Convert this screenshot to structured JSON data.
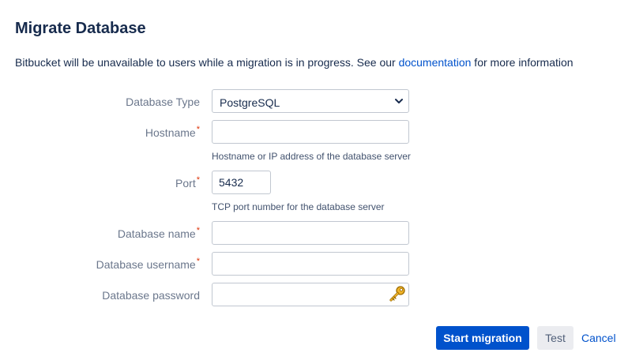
{
  "page": {
    "title": "Migrate Database",
    "intro_before": "Bitbucket will be unavailable to users while a migration is in progress. See our ",
    "intro_link": "documentation",
    "intro_after": " for more information"
  },
  "form": {
    "required_marker": "*",
    "database_type": {
      "label": "Database Type",
      "value": "PostgreSQL"
    },
    "hostname": {
      "label": "Hostname",
      "value": "",
      "help": "Hostname or IP address of the database server"
    },
    "port": {
      "label": "Port",
      "value": "5432",
      "help": "TCP port number for the database server"
    },
    "database_name": {
      "label": "Database name",
      "value": ""
    },
    "database_username": {
      "label": "Database username",
      "value": ""
    },
    "database_password": {
      "label": "Database password",
      "value": ""
    }
  },
  "actions": {
    "start_label": "Start migration",
    "test_label": "Test",
    "cancel_label": "Cancel"
  },
  "icons": {
    "select_chevron": "chevron-down-icon",
    "password_key": "key-icon"
  },
  "colors": {
    "primary": "#0052cc",
    "required": "#de350b",
    "label": "#6b778c",
    "heading": "#172b4d"
  }
}
